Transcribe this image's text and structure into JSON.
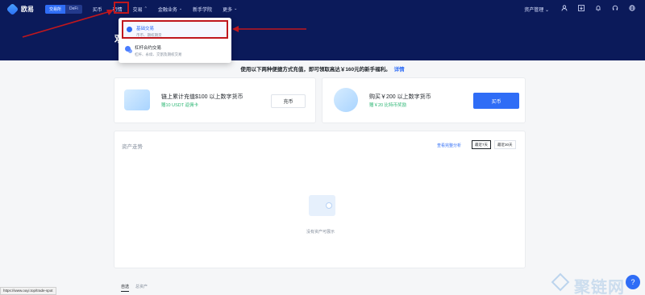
{
  "brand": {
    "name": "欧易"
  },
  "nav": {
    "segments": [
      "交易所",
      "DeFi"
    ],
    "items": [
      {
        "label": "买币",
        "has_dropdown": false
      },
      {
        "label": "行情",
        "has_dropdown": false
      },
      {
        "label": "交易",
        "has_dropdown": true
      },
      {
        "label": "金融业务",
        "has_dropdown": true
      },
      {
        "label": "新手学院",
        "has_dropdown": false
      },
      {
        "label": "更多",
        "has_dropdown": true
      }
    ],
    "right": {
      "asset_label": "资产管理",
      "icons": [
        "user-icon",
        "download-icon",
        "bell-icon",
        "headset-icon",
        "globe-icon"
      ]
    }
  },
  "hero": {
    "title": "欢"
  },
  "dropdown": {
    "items": [
      {
        "title": "基础交易",
        "subtitle": "币币、期权期货"
      },
      {
        "title": "杠杆合约交易",
        "subtitle": "杠杆、永续、交割及期权交易"
      }
    ]
  },
  "promo": {
    "text": "使用以下两种便捷方式充值，即可领取高达￥160元的新手福利。",
    "link": "详情"
  },
  "cards": [
    {
      "title": "链上累计充值$100 以上数字货币",
      "subtitle": "赠10 USDT 返佣卡",
      "button": "充币"
    },
    {
      "title": "购买￥200 以上数字货币",
      "subtitle": "赠￥20 比特币奖励",
      "button": "买币"
    }
  ],
  "asset_panel": {
    "title": "资产走势",
    "link": "查看完整分析",
    "ranges": [
      "最近7天",
      "最近30天"
    ],
    "empty_text": "没有资产可展示"
  },
  "bottom_tabs": [
    "自选",
    "总资产"
  ],
  "status_url": "https://www.ouyi.top/trade-spot",
  "watermark": "聚链网",
  "colors": {
    "nav_bg": "#0b1a5a",
    "accent": "#2f6df6",
    "highlight": "#c0171d",
    "success": "#2bb673"
  }
}
